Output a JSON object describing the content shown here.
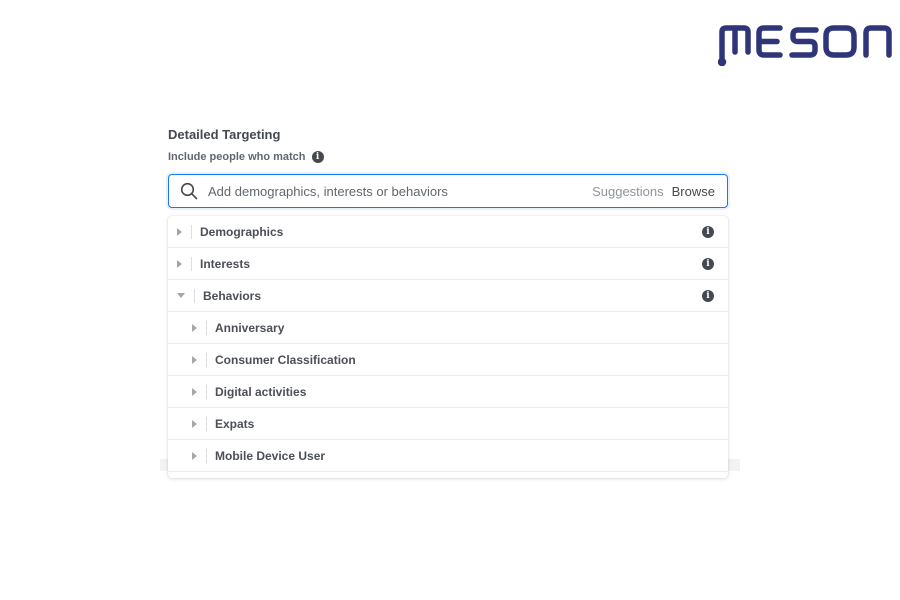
{
  "brand": {
    "logo_text": "MESON"
  },
  "targeting": {
    "title": "Detailed Targeting",
    "subtitle": "Include people who match",
    "search": {
      "placeholder": "Add demographics, interests or behaviors",
      "suggestions_label": "Suggestions",
      "browse_label": "Browse"
    },
    "categories": [
      {
        "label": "Demographics",
        "expanded": false
      },
      {
        "label": "Interests",
        "expanded": false
      },
      {
        "label": "Behaviors",
        "expanded": true
      }
    ],
    "behaviors_children": [
      {
        "label": "Anniversary"
      },
      {
        "label": "Consumer Classification"
      },
      {
        "label": "Digital activities"
      },
      {
        "label": "Expats"
      },
      {
        "label": "Mobile Device User"
      }
    ]
  },
  "colors": {
    "brand": "#2e3579",
    "accent": "#1877f2"
  }
}
